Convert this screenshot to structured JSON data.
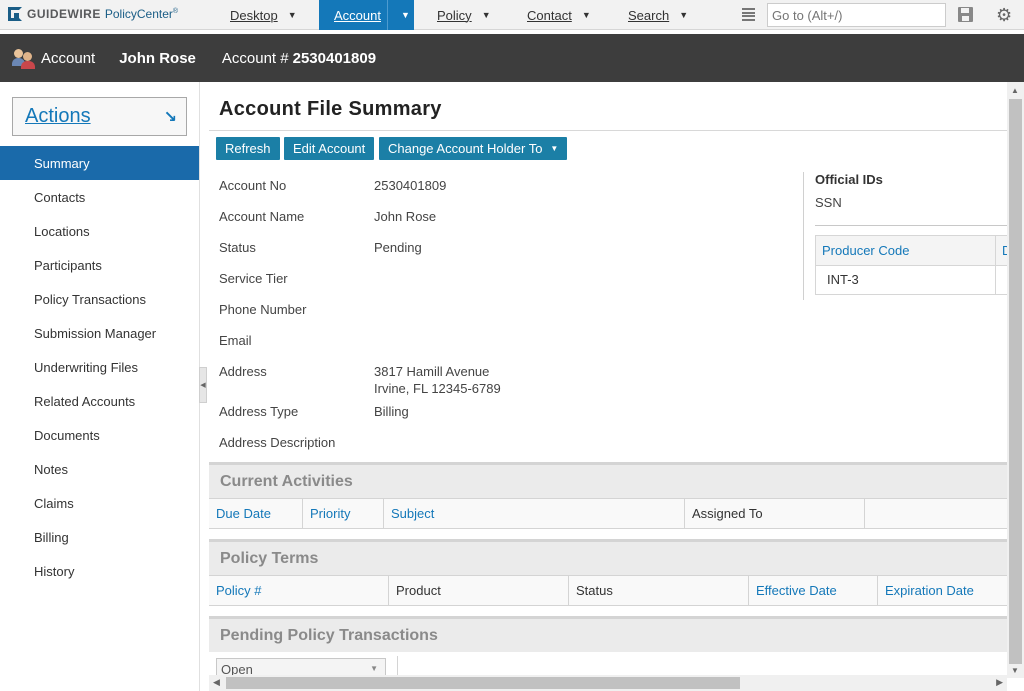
{
  "app": {
    "brand": "GUIDEWIRE",
    "product": "PolicyCenter",
    "product_mark": "®"
  },
  "nav": {
    "tabs": [
      {
        "label": "Desktop"
      },
      {
        "label": "Account"
      },
      {
        "label": "Policy"
      },
      {
        "label": "Contact"
      },
      {
        "label": "Search"
      }
    ],
    "goto_placeholder": "Go to (Alt+/)"
  },
  "account_bar": {
    "label": "Account",
    "holder_name": "John Rose",
    "number_label": "Account #",
    "number": "2530401809"
  },
  "sidebar": {
    "actions_label": "Actions",
    "items": [
      {
        "label": "Summary",
        "active": true
      },
      {
        "label": "Contacts"
      },
      {
        "label": "Locations"
      },
      {
        "label": "Participants"
      },
      {
        "label": "Policy Transactions"
      },
      {
        "label": "Submission Manager"
      },
      {
        "label": "Underwriting Files"
      },
      {
        "label": "Related Accounts"
      },
      {
        "label": "Documents"
      },
      {
        "label": "Notes"
      },
      {
        "label": "Claims"
      },
      {
        "label": "Billing"
      },
      {
        "label": "History"
      }
    ]
  },
  "main": {
    "title": "Account File Summary",
    "buttons": {
      "refresh": "Refresh",
      "edit_account": "Edit Account",
      "change_holder": "Change Account Holder To"
    },
    "fields": [
      {
        "label": "Account No",
        "value": "2530401809"
      },
      {
        "label": "Account Name",
        "value": "John Rose"
      },
      {
        "label": "Status",
        "value": "Pending"
      },
      {
        "label": "Service Tier",
        "value": ""
      },
      {
        "label": "Phone Number",
        "value": ""
      },
      {
        "label": "Email",
        "value": ""
      },
      {
        "label": "Address",
        "value_line1": "3817 Hamill Avenue",
        "value_line2": "Irvine, FL 12345-6789"
      },
      {
        "label": "Address Type",
        "value": "Billing"
      },
      {
        "label": "Address Description",
        "value": ""
      }
    ],
    "official_ids": {
      "title": "Official IDs",
      "ssn_label": "SSN",
      "producer_table": {
        "headers": [
          "Producer Code",
          "D"
        ],
        "rows": [
          [
            "INT-3"
          ]
        ]
      }
    },
    "current_activities": {
      "title": "Current Activities",
      "columns": [
        "Due Date",
        "Priority",
        "Subject",
        "Assigned To"
      ]
    },
    "policy_terms": {
      "title": "Policy Terms",
      "columns": [
        "Policy #",
        "Product",
        "Status",
        "Effective Date",
        "Expiration Date"
      ]
    },
    "pending_transactions": {
      "title": "Pending Policy Transactions",
      "filter_value": "Open"
    }
  }
}
